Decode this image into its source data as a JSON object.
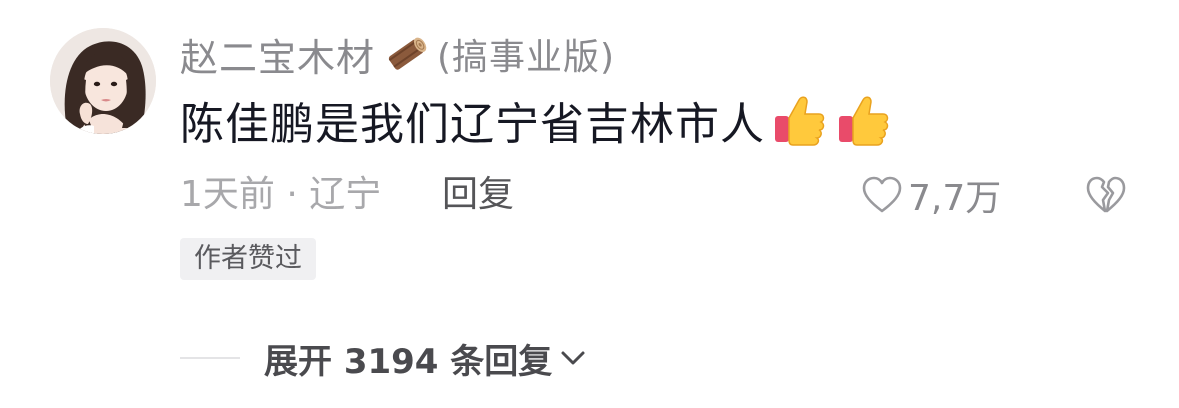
{
  "comment": {
    "avatar_icon": "avatar-photo-woman",
    "username": "赵二宝木材",
    "username_icon": "wood-log-icon",
    "edition": "(搞事业版)",
    "text": "陈佳鹏是我们辽宁省吉林市人",
    "text_emojis": [
      "thumbs-up-icon",
      "thumbs-up-icon"
    ],
    "meta": {
      "time": "1天前",
      "separator": "·",
      "location": "辽宁",
      "reply_label": "回复",
      "like_count": "7,7万",
      "like_icon": "heart-outline-icon",
      "dislike_icon": "broken-heart-icon"
    },
    "author_badge": "作者赞过",
    "expand_replies": {
      "label": "展开 3194 条回复",
      "icon": "chevron-down-icon"
    }
  },
  "colors": {
    "primary_text": "#161823",
    "secondary_text": "#8a8a8e",
    "meta_text": "#a8a8ab",
    "badge_bg": "#f0f0f2"
  }
}
